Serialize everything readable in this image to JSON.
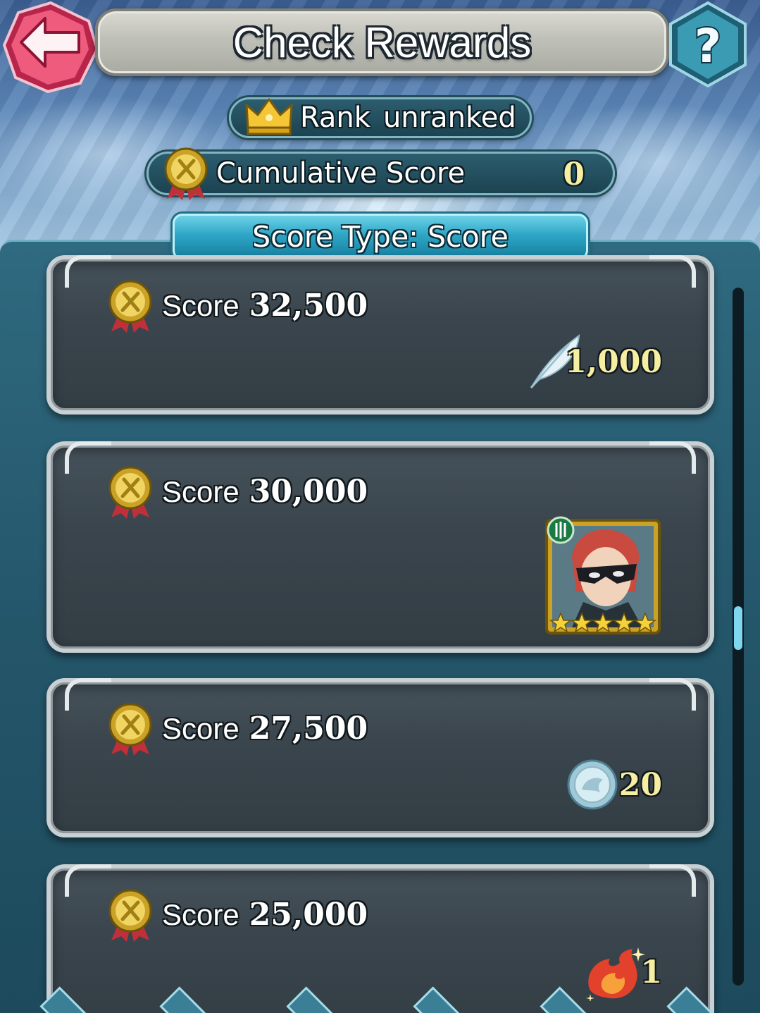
{
  "header": {
    "title": "Check Rewards",
    "back_icon": "arrow-left-icon",
    "help_icon": "question-mark-icon"
  },
  "rank": {
    "icon": "crown-icon",
    "label": "Rank",
    "value": "unranked"
  },
  "cumulative": {
    "icon": "medal-icon",
    "label": "Cumulative Score",
    "value": "0"
  },
  "score_type": {
    "label": "Score Type: Score"
  },
  "rewards": [
    {
      "label": "Score",
      "score": "32,500",
      "reward_icon": "feather-icon",
      "quantity": "1,000"
    },
    {
      "label": "Score",
      "score": "30,000",
      "reward_icon": "hero-portrait-icon",
      "quantity": ""
    },
    {
      "label": "Score",
      "score": "27,500",
      "reward_icon": "sacred-coin-icon",
      "quantity": "20"
    },
    {
      "label": "Score",
      "score": "25,000",
      "reward_icon": "flame-crest-icon",
      "quantity": "1"
    }
  ],
  "colors": {
    "accent_gold": "#f6eea0",
    "panel_teal": "#24566a",
    "back_button_pink": "#e8446c",
    "help_button_teal": "#3a9bb2"
  }
}
